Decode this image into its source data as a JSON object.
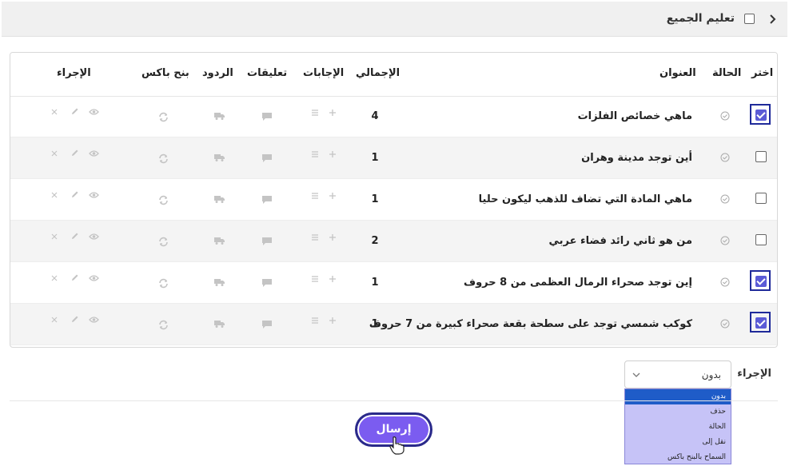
{
  "header": {
    "select_all_label": "تعليم الجميع"
  },
  "table": {
    "columns": {
      "select": "اختر",
      "status": "الحالة",
      "title": "العنوان",
      "total": "الإجمالي",
      "answers": "الإجابات",
      "comments": "تعليقات",
      "replies": "الردود",
      "bank": "بنح باكس",
      "action": "الإجراء"
    },
    "rows": [
      {
        "checked": true,
        "title": "ماهي خصائص الفلزات",
        "total": "4"
      },
      {
        "checked": false,
        "title": "أين توجد مدينة وهران",
        "total": "1"
      },
      {
        "checked": false,
        "title": "ماهي المادة التي تضاف للذهب ليكون حليا",
        "total": "1"
      },
      {
        "checked": false,
        "title": "من هو ثاني رائد فضاء عربي",
        "total": "2"
      },
      {
        "checked": true,
        "title": "إين توجد صحراء الرمال العظمى من 8 حروف",
        "total": "1"
      },
      {
        "checked": true,
        "title": "كوكب شمسي توجد على سطحة بقعة صحراء كبيرة من 7 حروف",
        "total": "1"
      }
    ]
  },
  "footer": {
    "action_label": "الإجراء",
    "select_value": "بدون",
    "options": [
      "بدون",
      "حذف",
      "الحالة",
      "نقل إلى",
      "السماح بالبنح باكس"
    ],
    "submit_label": "إرسال"
  },
  "colors": {
    "accent": "#5b5bd6",
    "button": "#7b5cf0",
    "dropdown_bg": "#c6c3f7",
    "dropdown_active": "#1f5cc8"
  }
}
